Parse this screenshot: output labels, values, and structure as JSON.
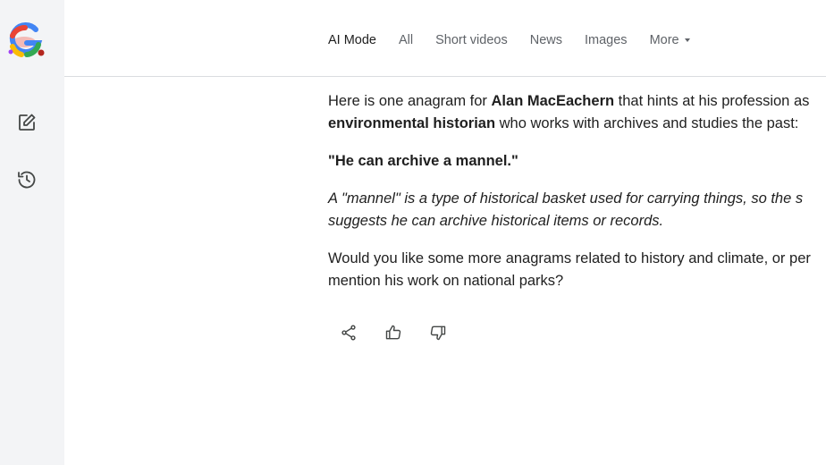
{
  "nav": {
    "tabs": [
      {
        "label": "AI Mode",
        "active": true
      },
      {
        "label": "All"
      },
      {
        "label": "Short videos"
      },
      {
        "label": "News"
      },
      {
        "label": "Images"
      }
    ],
    "more_label": "More"
  },
  "sidebar": {
    "logo_icon": "google-g-logo-icon",
    "items": [
      {
        "icon": "new-chat-edit-icon"
      },
      {
        "icon": "history-icon"
      }
    ]
  },
  "answer": {
    "p1_a": "Here is one anagram for ",
    "p1_name": "Alan MacEachern",
    "p1_b": " that hints at his profession as",
    "p1_line2_bold": "environmental historian",
    "p1_line2_rest": " who works with archives and studies the past:",
    "anagram": "\"He can archive a mannel.\"",
    "note_line1": "A \"mannel\" is a type of historical basket used for carrying things, so the s",
    "note_line2": "suggests he can archive historical items or records.",
    "followup_line1": "Would you like some more anagrams related to history and climate, or per",
    "followup_line2": "mention his work on national parks?"
  },
  "actions": [
    {
      "icon": "share-icon"
    },
    {
      "icon": "thumbs-up-icon"
    },
    {
      "icon": "thumbs-down-icon"
    }
  ],
  "colors": {
    "sidebar_bg": "#f3f4f6",
    "text": "#1f1f1f",
    "muted": "#5f6368",
    "divider": "#dadce0"
  }
}
